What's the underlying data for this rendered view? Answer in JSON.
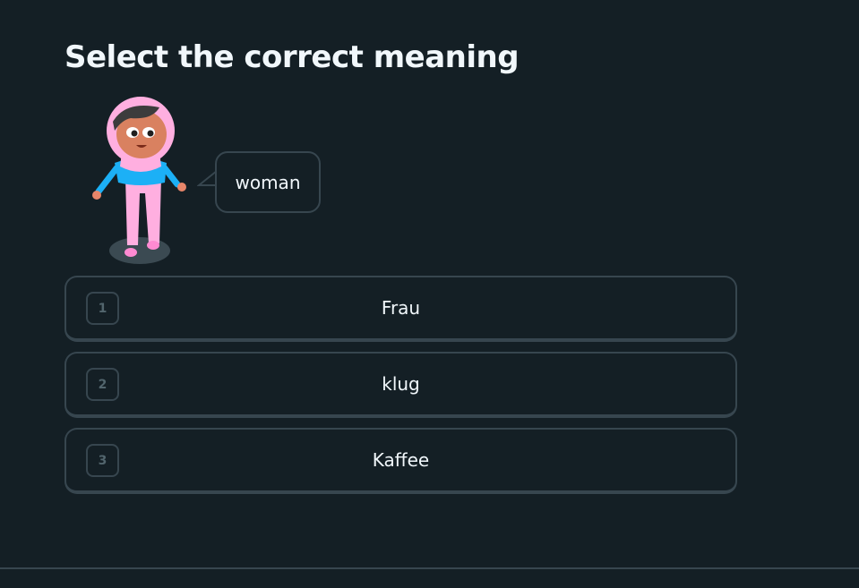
{
  "challenge": {
    "title": "Select the correct meaning",
    "prompt_word": "woman"
  },
  "options": [
    {
      "number": "1",
      "label": "Frau"
    },
    {
      "number": "2",
      "label": "klug"
    },
    {
      "number": "3",
      "label": "Kaffee"
    }
  ],
  "colors": {
    "background": "#141f25",
    "border": "#37464f",
    "text": "#f1f7fb",
    "muted": "#52656d"
  }
}
